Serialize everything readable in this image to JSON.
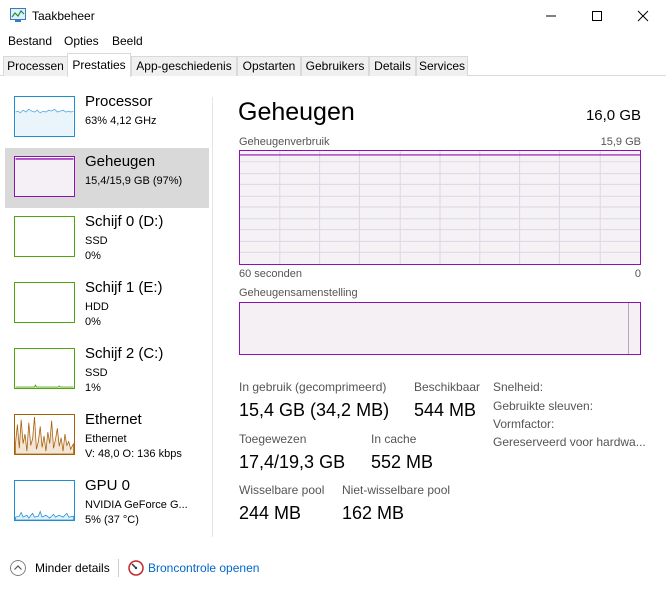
{
  "window": {
    "title": "Taakbeheer",
    "icon": "taskmanager-icon",
    "controls": [
      "minimize-icon",
      "maximize-icon",
      "close-icon"
    ]
  },
  "menu": [
    "Bestand",
    "Opties",
    "Beeld"
  ],
  "tabs": [
    {
      "label": "Processen",
      "active": false
    },
    {
      "label": "Prestaties",
      "active": true
    },
    {
      "label": "App-geschiedenis",
      "active": false
    },
    {
      "label": "Opstarten",
      "active": false
    },
    {
      "label": "Gebruikers",
      "active": false
    },
    {
      "label": "Details",
      "active": false
    },
    {
      "label": "Services",
      "active": false
    }
  ],
  "colors": {
    "cpu": "#1e8ed3",
    "memory": "#8b12ae",
    "disk": "#4da60c",
    "ethernet": "#a75f0a",
    "gpu": "#1e8ed3",
    "selected_bg": "#d9d9d9",
    "link": "#0066cc"
  },
  "resources": [
    {
      "name": "Processor",
      "sub1": "63% 4,12 GHz",
      "sub2": "",
      "selected": false
    },
    {
      "name": "Geheugen",
      "sub1": "15,4/15,9 GB (97%)",
      "sub2": "",
      "selected": true
    },
    {
      "name": "Schijf 0 (D:)",
      "sub1": "SSD",
      "sub2": "0%",
      "selected": false
    },
    {
      "name": "Schijf 1 (E:)",
      "sub1": "HDD",
      "sub2": "0%",
      "selected": false
    },
    {
      "name": "Schijf 2 (C:)",
      "sub1": "SSD",
      "sub2": "1%",
      "selected": false
    },
    {
      "name": "Ethernet",
      "sub1": "Ethernet",
      "sub2": "V: 48,0  O: 136 kbps",
      "selected": false
    },
    {
      "name": "GPU 0",
      "sub1": "NVIDIA GeForce G...",
      "sub2": "5% (37 °C)",
      "selected": false
    }
  ],
  "detail": {
    "title": "Geheugen",
    "total": "16,0 GB",
    "usage_label": "Geheugenverbruik",
    "usage_max": "15,9 GB",
    "time_label": "60 seconden",
    "time_end": "0",
    "composition_label": "Geheugensamenstelling",
    "stats": {
      "in_use_label": "In gebruik (gecomprimeerd)",
      "in_use_value": "15,4 GB (34,2 MB)",
      "available_label": "Beschikbaar",
      "available_value": "544 MB",
      "committed_label": "Toegewezen",
      "committed_value": "17,4/19,3 GB",
      "cached_label": "In cache",
      "cached_value": "552 MB",
      "paged_label": "Wisselbare pool",
      "paged_value": "244 MB",
      "nonpaged_label": "Niet-wisselbare pool",
      "nonpaged_value": "162 MB"
    },
    "properties": [
      "Snelheid:",
      "Gebruikte sleuven:",
      "Vormfactor:",
      "Gereserveerd voor hardwa..."
    ]
  },
  "footer": {
    "fewer_details": "Minder details",
    "open_monitor": "Broncontrole openen"
  }
}
